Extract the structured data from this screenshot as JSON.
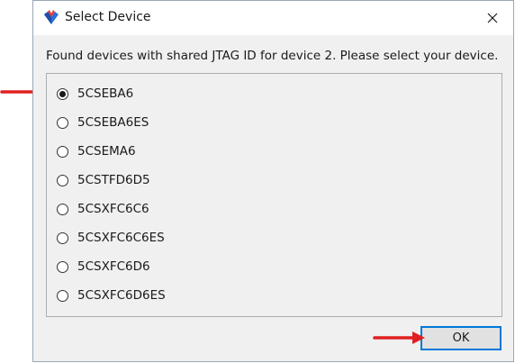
{
  "window": {
    "title": "Select Device",
    "icon": "quartus-logo-icon",
    "close_icon": "close-icon"
  },
  "instruction": "Found devices with shared JTAG ID for device 2. Please select your device.",
  "devices": [
    {
      "label": "5CSEBA6",
      "selected": true
    },
    {
      "label": "5CSEBA6ES",
      "selected": false
    },
    {
      "label": "5CSEMA6",
      "selected": false
    },
    {
      "label": "5CSTFD6D5",
      "selected": false
    },
    {
      "label": "5CSXFC6C6",
      "selected": false
    },
    {
      "label": "5CSXFC6C6ES",
      "selected": false
    },
    {
      "label": "5CSXFC6D6",
      "selected": false
    },
    {
      "label": "5CSXFC6D6ES",
      "selected": false
    }
  ],
  "buttons": {
    "ok": "OK"
  },
  "colors": {
    "annotation_arrow": "#e02020",
    "accent_border": "#0078d7"
  }
}
